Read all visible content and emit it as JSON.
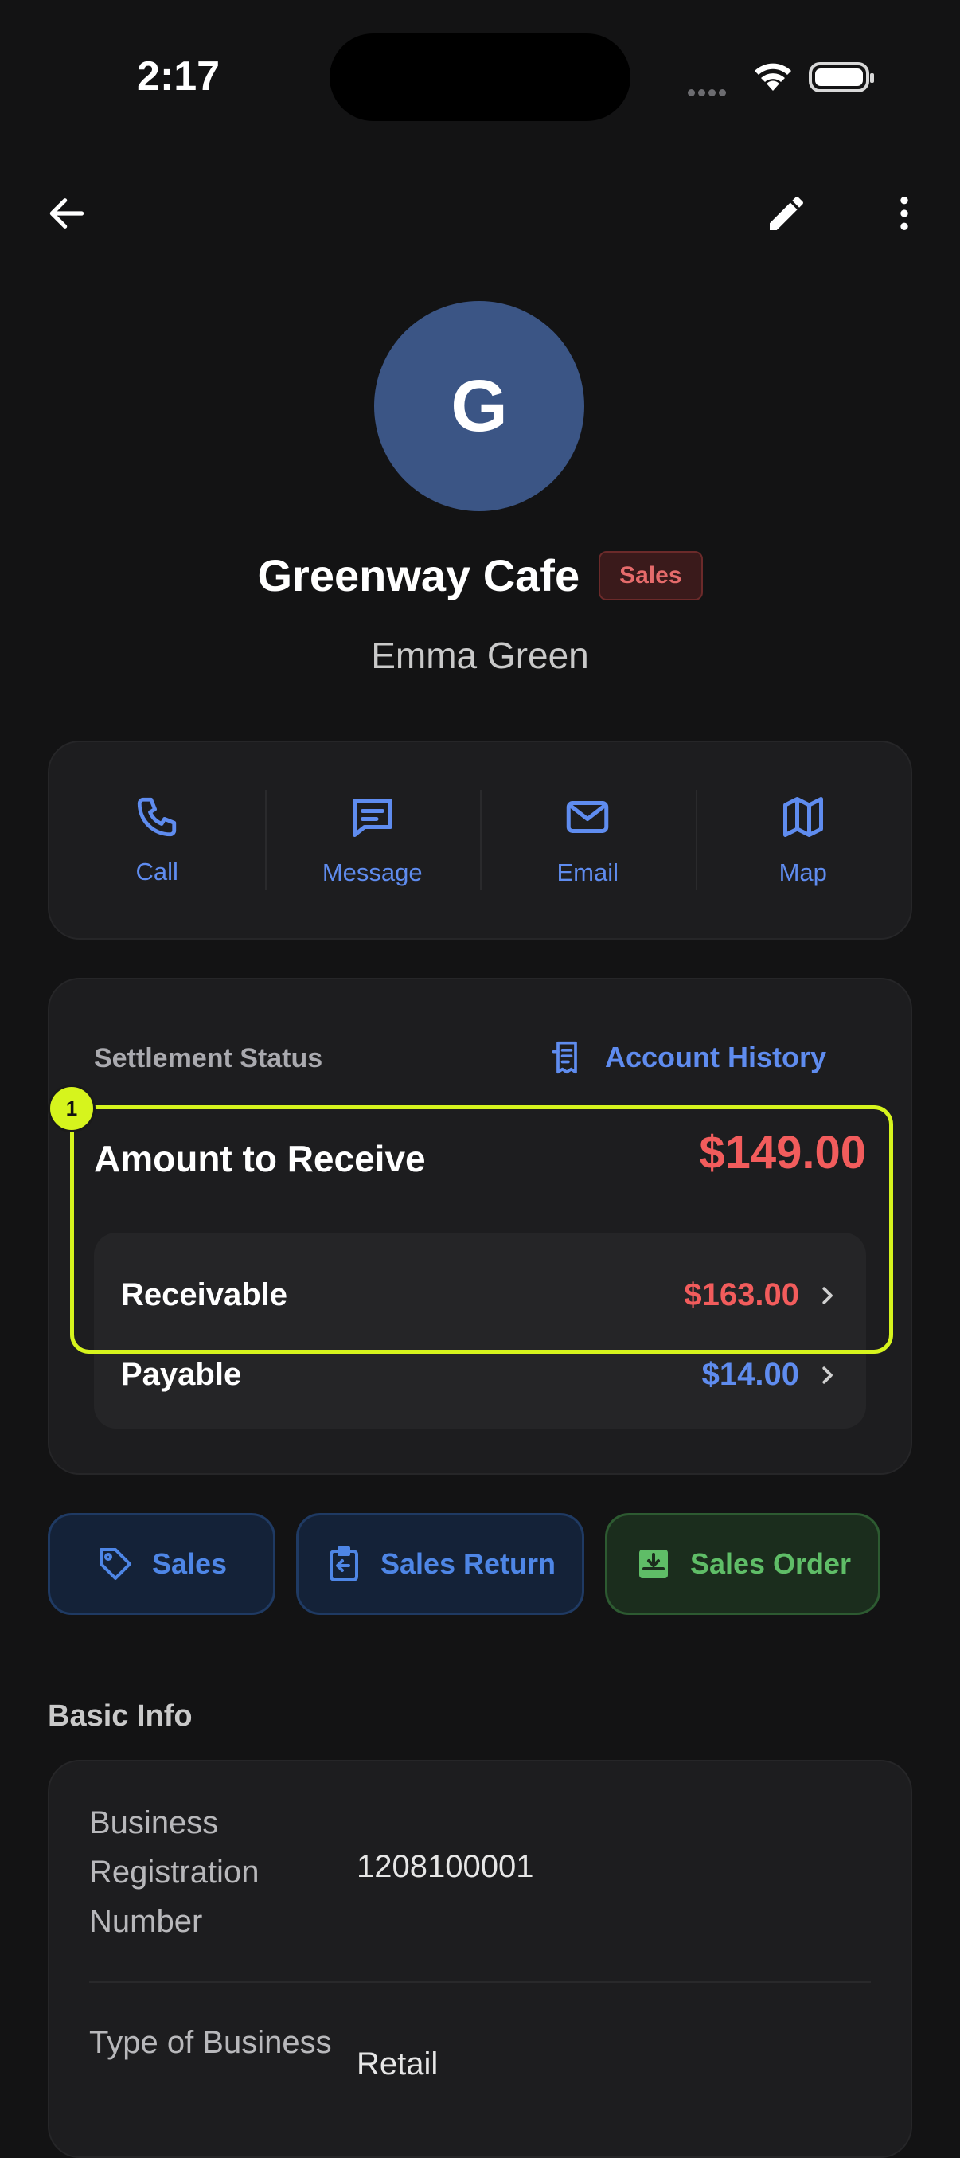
{
  "status_bar": {
    "time": "2:17"
  },
  "header": {
    "back_icon": "arrow-left-icon",
    "edit_icon": "pencil-icon",
    "more_icon": "more-vertical-icon"
  },
  "profile": {
    "initial": "G",
    "name": "Greenway Cafe",
    "badge": "Sales",
    "contact": "Emma Green"
  },
  "actions": [
    {
      "label": "Call",
      "icon": "phone-icon"
    },
    {
      "label": "Message",
      "icon": "message-icon"
    },
    {
      "label": "Email",
      "icon": "mail-icon"
    },
    {
      "label": "Map",
      "icon": "map-icon"
    }
  ],
  "settlement": {
    "title": "Settlement Status",
    "history_label": "Account History",
    "amount_label": "Amount to Receive",
    "amount_value": "$149.00",
    "rows": [
      {
        "label": "Receivable",
        "value": "$163.00"
      },
      {
        "label": "Payable",
        "value": "$14.00"
      }
    ]
  },
  "highlight": {
    "number": "1"
  },
  "chips": [
    {
      "label": "Sales"
    },
    {
      "label": "Sales Return"
    },
    {
      "label": "Sales Order"
    }
  ],
  "basic_info": {
    "title": "Basic Info",
    "fields": [
      {
        "label": "Business Registration Number",
        "value": "1208100001"
      },
      {
        "label": "Type of Business",
        "value": "Retail"
      }
    ]
  },
  "colors": {
    "accent": "#5f8cef",
    "negative": "#f25c5c",
    "highlight": "#d6f41d",
    "success": "#5fbd67"
  }
}
